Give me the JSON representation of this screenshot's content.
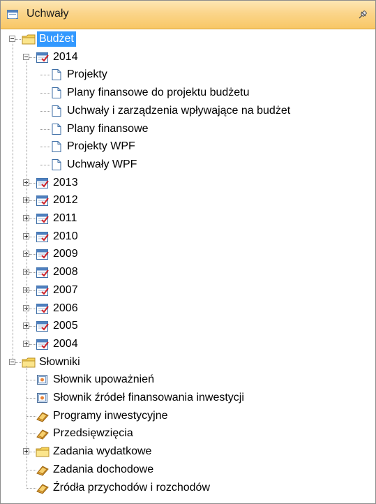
{
  "panel": {
    "title": "Uchwały",
    "title_icon": "grid-window-icon",
    "pin_icon": "pin-icon"
  },
  "tree": {
    "root_budget": {
      "label": "Budżet",
      "icon": "folder-icon"
    },
    "year_2014": {
      "label": "2014",
      "icon": "calendar-icon"
    },
    "year_2014_children": [
      {
        "label": "Projekty",
        "icon": "document-icon"
      },
      {
        "label": "Plany finansowe do projektu budżetu",
        "icon": "document-icon"
      },
      {
        "label": "Uchwały i zarządzenia wpływające na budżet",
        "icon": "document-icon"
      },
      {
        "label": "Plany finansowe",
        "icon": "document-icon"
      },
      {
        "label": "Projekty WPF",
        "icon": "document-icon"
      },
      {
        "label": "Uchwały WPF",
        "icon": "document-icon"
      }
    ],
    "other_years": [
      {
        "label": "2013",
        "icon": "calendar-icon"
      },
      {
        "label": "2012",
        "icon": "calendar-icon"
      },
      {
        "label": "2011",
        "icon": "calendar-icon"
      },
      {
        "label": "2010",
        "icon": "calendar-icon"
      },
      {
        "label": "2009",
        "icon": "calendar-icon"
      },
      {
        "label": "2008",
        "icon": "calendar-icon"
      },
      {
        "label": "2007",
        "icon": "calendar-icon"
      },
      {
        "label": "2006",
        "icon": "calendar-icon"
      },
      {
        "label": "2005",
        "icon": "calendar-icon"
      },
      {
        "label": "2004",
        "icon": "calendar-icon"
      }
    ],
    "root_dicts": {
      "label": "Słowniki",
      "icon": "folder-icon"
    },
    "dict_children": [
      {
        "label": "Słownik upoważnień",
        "icon": "dictionary-icon",
        "expandable": false
      },
      {
        "label": "Słownik źródeł finansowania inwestycji",
        "icon": "dictionary-icon",
        "expandable": false
      },
      {
        "label": "Programy inwestycyjne",
        "icon": "register-icon",
        "expandable": false
      },
      {
        "label": "Przedsięwzięcia",
        "icon": "register-icon",
        "expandable": false
      },
      {
        "label": "Zadania wydatkowe",
        "icon": "folder-icon",
        "expandable": true
      },
      {
        "label": "Zadania dochodowe",
        "icon": "register-icon",
        "expandable": false
      },
      {
        "label": "Źródła przychodów i rozchodów",
        "icon": "register-icon",
        "expandable": false
      }
    ]
  }
}
